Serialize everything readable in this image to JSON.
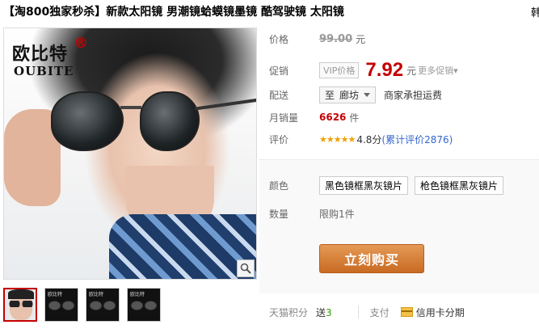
{
  "title": "【淘800独家秒杀】新款太阳镜 男潮镜蛤蟆镜墨镜 酷驾驶镜 太阳镜",
  "title_overflow": "韩",
  "gallery": {
    "brand_cn": "欧比特",
    "brand_reg": "®",
    "brand_en": "OUBITE",
    "zoom_icon": "magnifier-icon",
    "thumb_brand": "欧比特"
  },
  "price": {
    "label": "价格",
    "original": "99.00",
    "unit": "元"
  },
  "promo": {
    "label": "促销",
    "vip_tag": "VIP价格",
    "price": "7.92",
    "unit": "元",
    "more": "更多促销▾"
  },
  "delivery": {
    "label": "配送",
    "prefix": "至",
    "location": "廊坊",
    "shipping": "商家承担运费"
  },
  "sales": {
    "label": "月销量",
    "count": "6626",
    "unit": "件"
  },
  "rating": {
    "label": "评价",
    "stars": "★★★★★",
    "score": "4.8分",
    "review": "(累计评价2876)"
  },
  "sku": {
    "color_label": "颜色",
    "options": [
      "黑色镜框黑灰镜片",
      "枪色镜框黑灰镜片"
    ],
    "qty_label": "数量",
    "qty_limit": "限购1件",
    "buy_label": "立刻购买"
  },
  "footer": {
    "points_label": "天猫积分",
    "give_prefix": "送",
    "give_value": "3",
    "pay_label": "支付",
    "pay_method": "信用卡分期"
  }
}
